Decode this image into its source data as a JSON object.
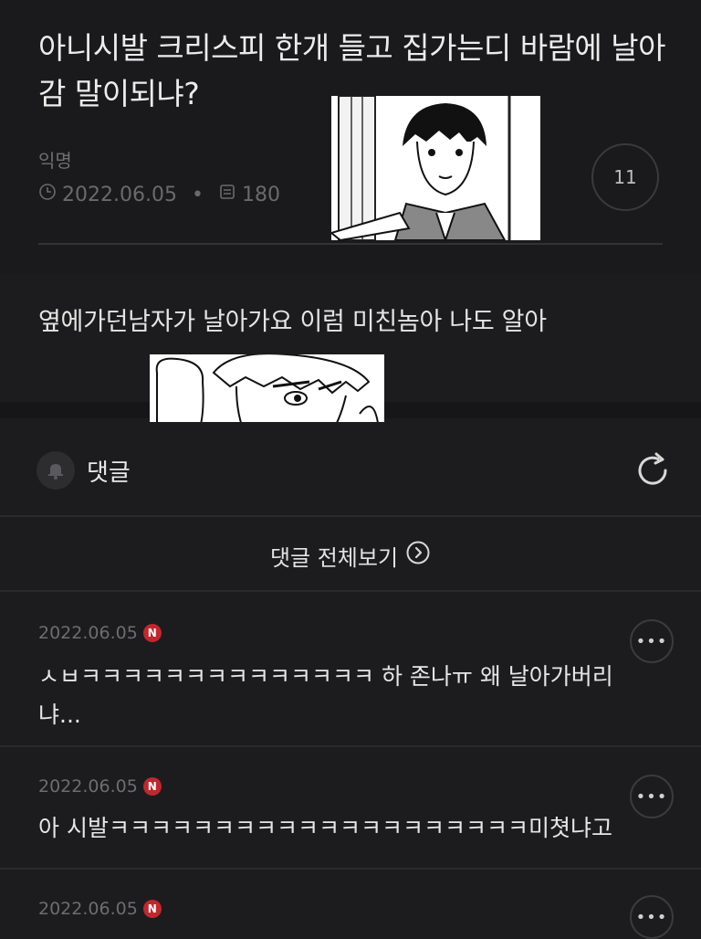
{
  "post": {
    "title": "아니시발 크리스피 한개 들고 집가는디 바람에 날아감 말이되냐?",
    "author": "익명",
    "date": "2022.06.05",
    "views": "180",
    "comment_count": "11",
    "body": "옆에가던남자가 날아가요 이럼 미친놈아 나도 알아"
  },
  "comment_section": {
    "label": "댓글",
    "view_all_label": "댓글 전체보기"
  },
  "comments": [
    {
      "date": "2022.06.05",
      "badge": "N",
      "text": "ㅅㅂㅋㅋㅋㅋㅋㅋㅋㅋㅋㅋㅋㅋㅋㅋ 하 존나ㅠ 왜 날아가버리냐..."
    },
    {
      "date": "2022.06.05",
      "badge": "N",
      "text": "아 시발ㅋㅋㅋㅋㅋㅋㅋㅋㅋㅋㅋㅋㅋㅋㅋㅋㅋㅋㅋㅋ미쳣냐고"
    },
    {
      "date": "2022.06.05",
      "badge": "N",
      "text": ""
    }
  ],
  "icons": {
    "clock": "clock-icon",
    "views": "views-icon",
    "bell": "bell-icon",
    "refresh": "refresh-icon",
    "chevron": "chevron-right-circle-icon",
    "more": "more-icon"
  },
  "colors": {
    "background": "#1c1c1e",
    "new_badge": "#c1272d"
  }
}
